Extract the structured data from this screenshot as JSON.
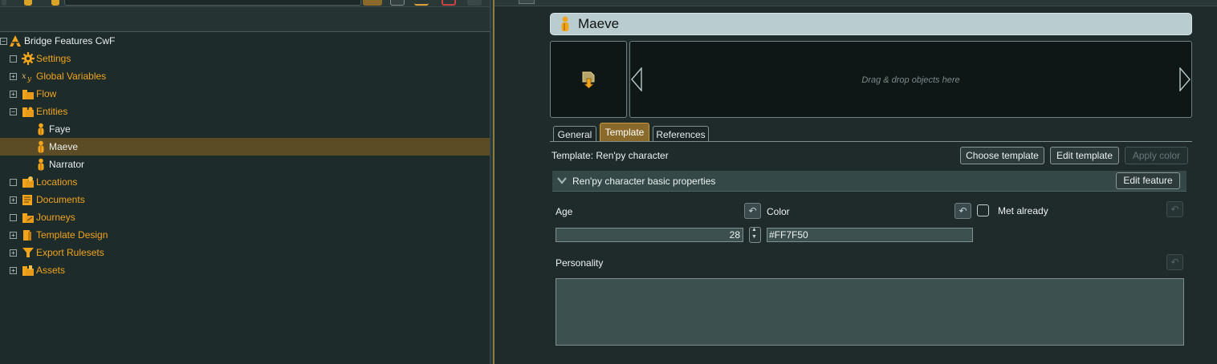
{
  "tree": {
    "root": {
      "label": "Bridge Features CwF",
      "icon": "project-icon"
    },
    "items": [
      {
        "label": "Settings",
        "icon": "gear-icon",
        "expander": "",
        "color": "orange"
      },
      {
        "label": "Global Variables",
        "icon": "variable-icon",
        "expander": "+",
        "color": "orange"
      },
      {
        "label": "Flow",
        "icon": "folder-icon",
        "expander": "+",
        "color": "orange"
      },
      {
        "label": "Entities",
        "icon": "entities-folder-icon",
        "expander": "−",
        "color": "orange"
      },
      {
        "label": "Faye",
        "icon": "character-icon",
        "expander": null,
        "color": "white"
      },
      {
        "label": "Maeve",
        "icon": "character-icon",
        "expander": null,
        "color": "white",
        "selected": true
      },
      {
        "label": "Narrator",
        "icon": "character-icon",
        "expander": null,
        "color": "white"
      },
      {
        "label": "Locations",
        "icon": "locations-folder-icon",
        "expander": "",
        "color": "orange"
      },
      {
        "label": "Documents",
        "icon": "documents-folder-icon",
        "expander": "+",
        "color": "orange"
      },
      {
        "label": "Journeys",
        "icon": "journeys-folder-icon",
        "expander": "",
        "color": "orange"
      },
      {
        "label": "Template Design",
        "icon": "template-folder-icon",
        "expander": "+",
        "color": "orange"
      },
      {
        "label": "Export Rulesets",
        "icon": "export-folder-icon",
        "expander": "+",
        "color": "orange"
      },
      {
        "label": "Assets",
        "icon": "assets-folder-icon",
        "expander": "+",
        "color": "orange"
      }
    ]
  },
  "entity": {
    "title": "Maeve",
    "drop_placeholder": "Drag & drop objects here"
  },
  "tabs": [
    {
      "label": "General",
      "active": false
    },
    {
      "label": "Template",
      "active": true
    },
    {
      "label": "References",
      "active": false
    }
  ],
  "template": {
    "label": "Template: Ren'py character",
    "choose_button": "Choose template",
    "edit_button": "Edit template",
    "apply_color_button": "Apply color"
  },
  "feature": {
    "title": "Ren'py character basic properties",
    "edit_button": "Edit feature",
    "properties": {
      "age_label": "Age",
      "age_value": "28",
      "color_label": "Color",
      "color_value": "#FF7F50",
      "met_label": "Met already",
      "met_checked": false,
      "personality_label": "Personality",
      "personality_value": ""
    }
  },
  "colors": {
    "accent_orange": "#f2a41c",
    "selection": "#5c4c26",
    "title_bar": "#b9cdd1"
  }
}
